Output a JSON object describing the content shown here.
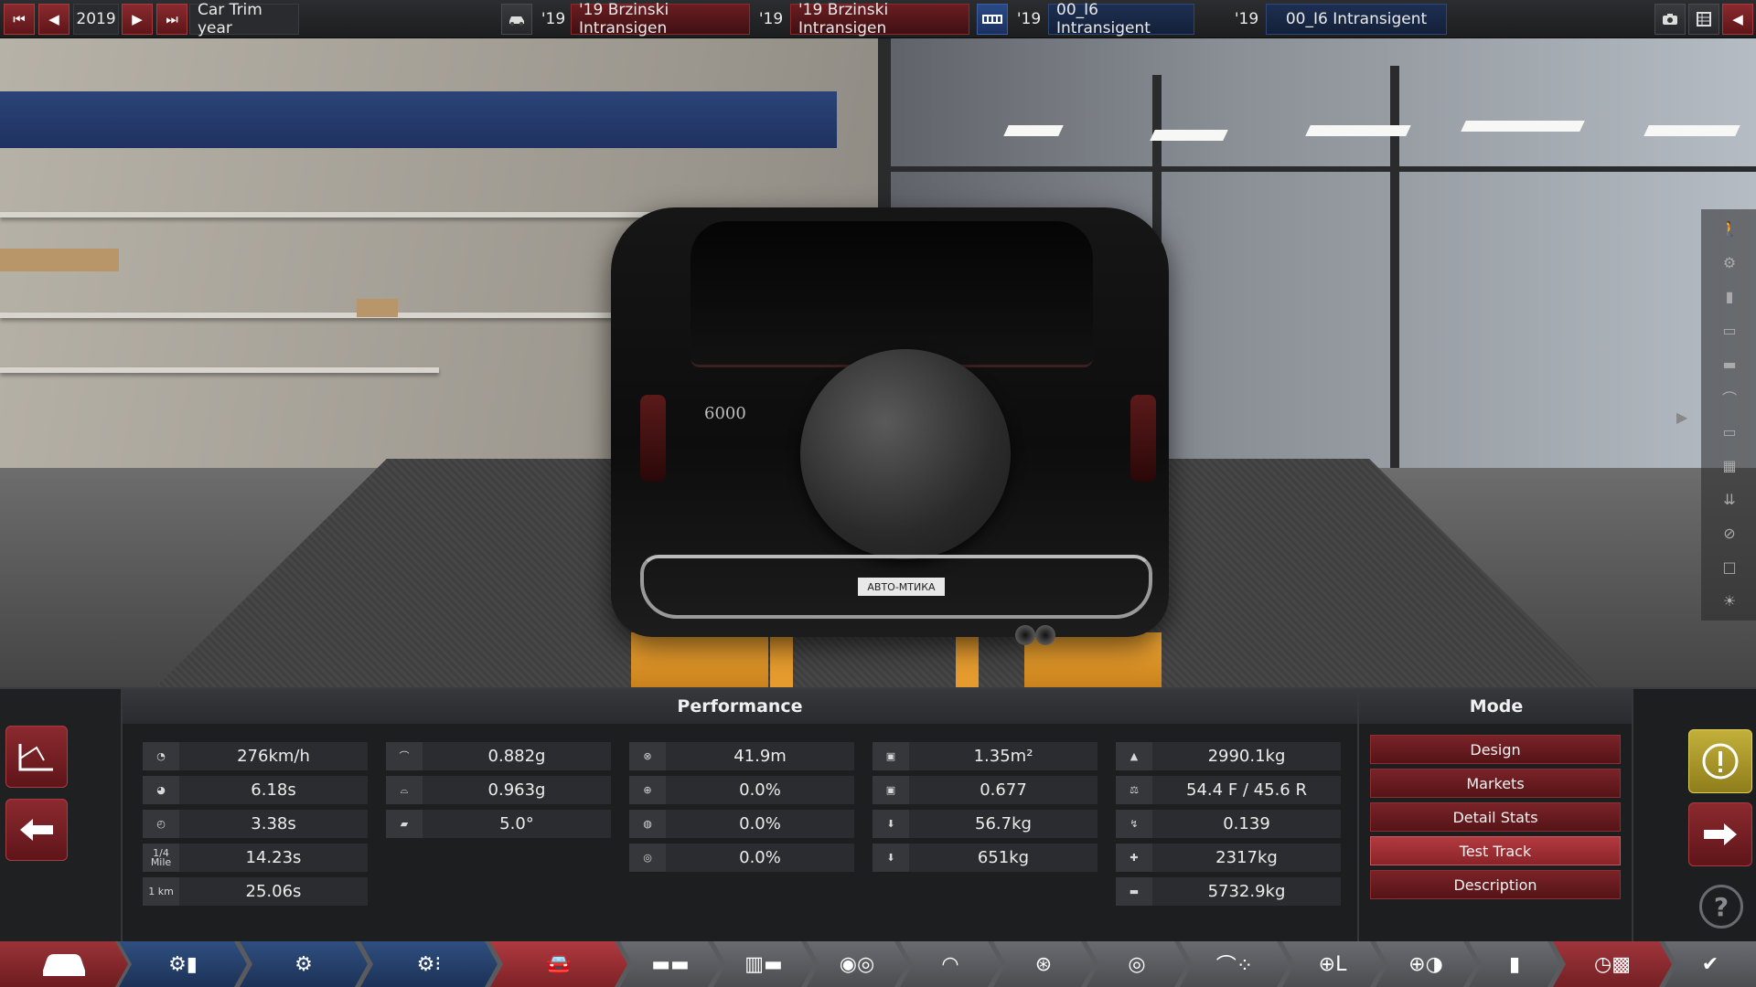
{
  "topbar": {
    "year": "2019",
    "trim_year_label": "Car Trim year",
    "model_year_1": "'19",
    "model_name_1": "'19 Brzinski Intransigen",
    "model_year_2": "'19",
    "model_name_2": "'19 Brzinski Intransigen",
    "engine_year_1": "'19",
    "engine_name_1": "00_I6 Intransigent",
    "engine_year_2": "'19",
    "engine_name_2": "00_I6 Intransigent"
  },
  "car": {
    "plate_text": "АВТО-МТИКА",
    "badge_text": "6000"
  },
  "performance": {
    "title": "Performance",
    "col1": [
      {
        "icon": "top-speed-icon",
        "value": "276km/h"
      },
      {
        "icon": "acceleration-100-icon",
        "value": "6.18s"
      },
      {
        "icon": "acceleration-60-icon",
        "value": "3.38s"
      },
      {
        "icon": "quarter-mile-icon",
        "icon_text": "1/4 Mile",
        "value": "14.23s"
      },
      {
        "icon": "one-km-icon",
        "icon_text": "1 km",
        "value": "25.06s"
      }
    ],
    "col2": [
      {
        "icon": "cornering-slow-icon",
        "value": "0.882g"
      },
      {
        "icon": "cornering-fast-icon",
        "value": "0.963g"
      },
      {
        "icon": "body-roll-icon",
        "value": "5.0°"
      }
    ],
    "col3": [
      {
        "icon": "braking-distance-icon",
        "value": "41.9m"
      },
      {
        "icon": "brake-fade-icon",
        "value": "0.0%"
      },
      {
        "icon": "brake-fade-hot-icon",
        "value": "0.0%"
      },
      {
        "icon": "brake-fade-wet-icon",
        "value": "0.0%"
      }
    ],
    "col4": [
      {
        "icon": "frontal-area-icon",
        "value": "1.35m²"
      },
      {
        "icon": "drag-coefficient-icon",
        "value": "0.677"
      },
      {
        "icon": "downforce-front-icon",
        "value": "56.7kg"
      },
      {
        "icon": "downforce-rear-icon",
        "value": "651kg"
      }
    ],
    "col5": [
      {
        "icon": "weight-icon",
        "value": "2990.1kg"
      },
      {
        "icon": "weight-distribution-icon",
        "value": "54.4 F / 45.6 R"
      },
      {
        "icon": "lift-icon",
        "value": "0.139"
      },
      {
        "icon": "towing-icon",
        "value": "2317kg"
      },
      {
        "icon": "gross-weight-icon",
        "value": "5732.9kg"
      }
    ]
  },
  "mode": {
    "title": "Mode",
    "buttons": [
      "Design",
      "Markets",
      "Detail Stats",
      "Test Track",
      "Description"
    ],
    "active": "Test Track"
  },
  "nav": {
    "items": [
      "car-model-icon",
      "engine-tools-icon",
      "engine-blocks-icon",
      "engine-parts-icon",
      "trim-icon",
      "chassis-icon",
      "suspension-icon",
      "drivetrain-icon",
      "brakes-icon",
      "wheels-icon",
      "tyre-icon",
      "body-icon",
      "interior-icon",
      "safety-icon",
      "fuel-icon",
      "test-track-icon",
      "finish-icon"
    ],
    "active_index": 4
  },
  "colors": {
    "accent_red": "#8b2a2f",
    "active_red": "#b23a40",
    "nav_blue": "#2b4a7a",
    "warning_yellow": "#c2b03a"
  }
}
